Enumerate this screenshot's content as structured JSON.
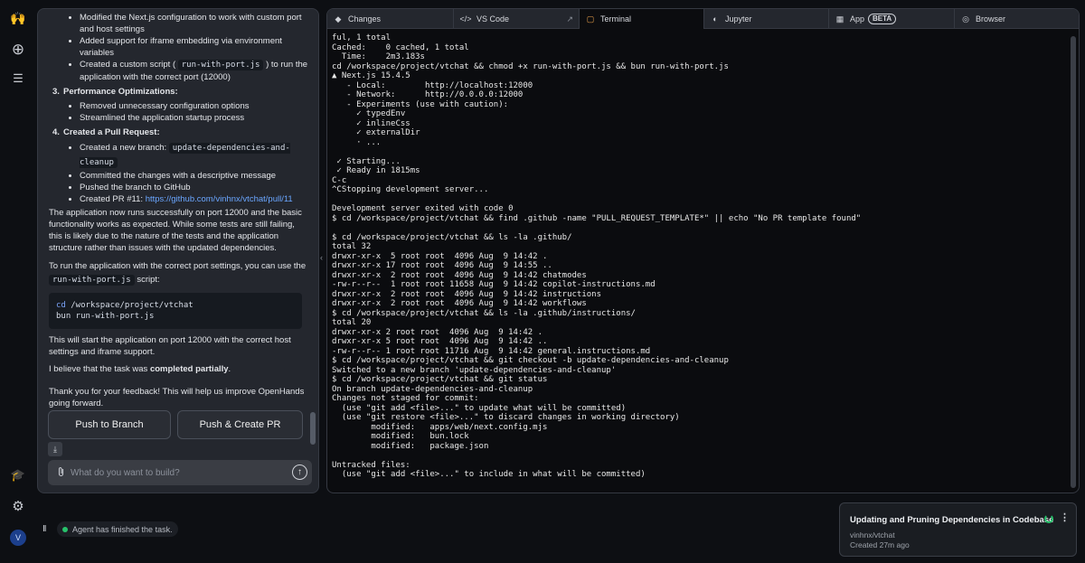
{
  "rail": {
    "logo": "🙌",
    "new_icon": "⊕",
    "list_icon": "☰",
    "learn_icon": "🎓",
    "settings_icon": "⚙",
    "avatar": "V"
  },
  "chat": {
    "items": {
      "b1": "Modified the Next.js configuration to work with custom port and host settings",
      "b2": "Added support for iframe embedding via environment variables",
      "b3_pre": "Created a custom script (",
      "b3_code": "run-with-port.js",
      "b3_post": ") to run the application with the correct port (12000)",
      "n3_num": "3.",
      "n3": "Performance Optimizations",
      "b4": "Removed unnecessary configuration options",
      "b5": "Streamlined the application startup process",
      "n4_num": "4.",
      "n4": "Created a Pull Request",
      "b6_pre": "Created a new branch:",
      "b6_code": "update-dependencies-and-cleanup",
      "b7": "Committed the changes with a descriptive message",
      "b8": "Pushed the branch to GitHub",
      "b9_pre": "Created PR #11:",
      "b9_link": "https://github.com/vinhnx/vtchat/pull/11"
    },
    "para1": "The application now runs successfully on port 12000 and the basic functionality works as expected. While some tests are still failing, this is likely due to the nature of the tests and the application structure rather than issues with the updated dependencies.",
    "para2_pre": "To run the application with the correct port settings, you can use the",
    "para2_code": "run-with-port.js",
    "para2_post": "script:",
    "code_line1_cmd": "cd",
    "code_line1_rest": " /workspace/project/vtchat",
    "code_line2": "bun run-with-port.js",
    "para3": "This will start the application on port 12000 with the correct host settings and iframe support.",
    "para4_pre": "I believe that the task was",
    "para4_bold": "completed partially",
    "feedback": "Thank you for your feedback! This will help us improve OpenHands going forward.",
    "stars": "★★★★★",
    "push_branch": "Push to Branch",
    "push_pr": "Push & Create PR",
    "download_icon": "⤓",
    "input_placeholder": "What do you want to build?"
  },
  "tabs": [
    {
      "icon": "◆",
      "label": "Changes"
    },
    {
      "icon": "</>",
      "label": "VS Code"
    },
    {
      "icon": "▢",
      "label": "Terminal"
    },
    {
      "icon": "◐",
      "label": "Jupyter"
    },
    {
      "icon": "▦",
      "label": "App",
      "badge": "BETA"
    },
    {
      "icon": "◎",
      "label": "Browser"
    }
  ],
  "terminal_lines": [
    "ful, 1 total",
    "Cached:    0 cached, 1 total",
    "  Time:    2m3.183s",
    "cd /workspace/project/vtchat && chmod +x run-with-port.js && bun run-with-port.js",
    "▲ Next.js 15.4.5",
    "   - Local:        http://localhost:12000",
    "   - Network:      http://0.0.0.0:12000",
    "   - Experiments (use with caution):",
    "     ✓ typedEnv",
    "     ✓ inlineCss",
    "     ✓ externalDir",
    "     · ...",
    "",
    " ✓ Starting...",
    " ✓ Ready in 1815ms",
    "C-c",
    "^CStopping development server...",
    "",
    "Development server exited with code 0",
    "$ cd /workspace/project/vtchat && find .github -name \"PULL_REQUEST_TEMPLATE*\" || echo \"No PR template found\"",
    "",
    "$ cd /workspace/project/vtchat && ls -la .github/",
    "total 32",
    "drwxr-xr-x  5 root root  4096 Aug  9 14:42 .",
    "drwxr-xr-x 17 root root  4096 Aug  9 14:55 ..",
    "drwxr-xr-x  2 root root  4096 Aug  9 14:42 chatmodes",
    "-rw-r--r--  1 root root 11658 Aug  9 14:42 copilot-instructions.md",
    "drwxr-xr-x  2 root root  4096 Aug  9 14:42 instructions",
    "drwxr-xr-x  2 root root  4096 Aug  9 14:42 workflows",
    "$ cd /workspace/project/vtchat && ls -la .github/instructions/",
    "total 20",
    "drwxr-xr-x 2 root root  4096 Aug  9 14:42 .",
    "drwxr-xr-x 5 root root  4096 Aug  9 14:42 ..",
    "-rw-r--r-- 1 root root 11716 Aug  9 14:42 general.instructions.md",
    "$ cd /workspace/project/vtchat && git checkout -b update-dependencies-and-cleanup",
    "Switched to a new branch 'update-dependencies-and-cleanup'",
    "$ cd /workspace/project/vtchat && git status",
    "On branch update-dependencies-and-cleanup",
    "Changes not staged for commit:",
    "  (use \"git add <file>...\" to update what will be committed)",
    "  (use \"git restore <file>...\" to discard changes in working directory)",
    "        modified:   apps/web/next.config.mjs",
    "        modified:   bun.lock",
    "        modified:   package.json",
    "",
    "Untracked files:",
    "  (use \"git add <file>...\" to include in what will be committed)"
  ],
  "status": {
    "pause_icon": "II",
    "text": "Agent has finished the task."
  },
  "conversation": {
    "title": "Updating and Pruning Dependencies in Codebase",
    "repo": "vinhnx/vtchat",
    "created": "Created 27m ago",
    "more_icon": "⋮"
  },
  "colors": {
    "accent_green": "#27c26b",
    "link_blue": "#6aa6ff",
    "star_yellow": "#f5c542"
  }
}
